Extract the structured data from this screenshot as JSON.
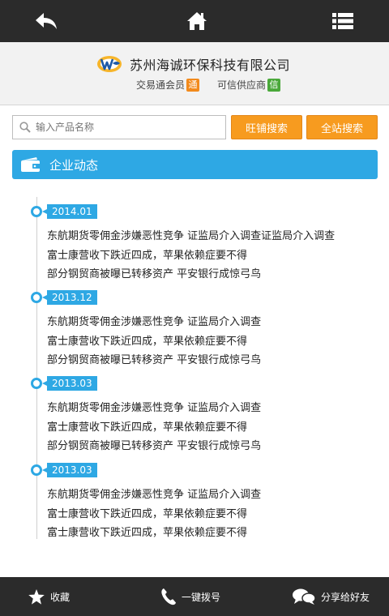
{
  "company": {
    "name": "苏州海诚环保科技有限公司",
    "member_label": "交易通会员",
    "member_badge": "通",
    "supplier_label": "可信供应商",
    "supplier_badge": "信"
  },
  "search": {
    "placeholder": "输入产品名称",
    "shop_search_label": "旺铺搜索",
    "site_search_label": "全站搜索"
  },
  "section": {
    "title": "企业动态"
  },
  "timeline": [
    {
      "date": "2014.01",
      "items": [
        "东航期货零佣金涉嫌恶性竞争 证监局介入调查证监局介入调查",
        "富士康营收下跌近四成，苹果依赖症要不得",
        "部分钢贸商被曝已转移资产 平安银行成惊弓鸟"
      ]
    },
    {
      "date": "2013.12",
      "items": [
        "东航期货零佣金涉嫌恶性竞争 证监局介入调查",
        "富士康营收下跌近四成，苹果依赖症要不得",
        "部分钢贸商被曝已转移资产 平安银行成惊弓鸟"
      ]
    },
    {
      "date": "2013.03",
      "items": [
        "东航期货零佣金涉嫌恶性竞争 证监局介入调查",
        "富士康营收下跌近四成，苹果依赖症要不得",
        "部分钢贸商被曝已转移资产 平安银行成惊弓鸟"
      ]
    },
    {
      "date": "2013.03",
      "items": [
        "东航期货零佣金涉嫌恶性竞争 证监局介入调查",
        "富士康营收下跌近四成，苹果依赖症要不得",
        "富士康营收下跌近四成，苹果依赖症要不得"
      ]
    }
  ],
  "bottom": {
    "favorite_label": "收藏",
    "call_label": "一键拨号",
    "share_label": "分享给好友"
  },
  "colors": {
    "accent": "#2ea8e4",
    "button_orange": "#f79b1f",
    "bar_dark": "#2b2b2b"
  },
  "icons": {
    "top": [
      "back-arrow-icon",
      "home-icon",
      "list-menu-icon"
    ],
    "bottom": [
      "star-icon",
      "phone-icon",
      "chat-bubble-icon"
    ],
    "search": "search-icon",
    "section": "wallet-icon"
  }
}
